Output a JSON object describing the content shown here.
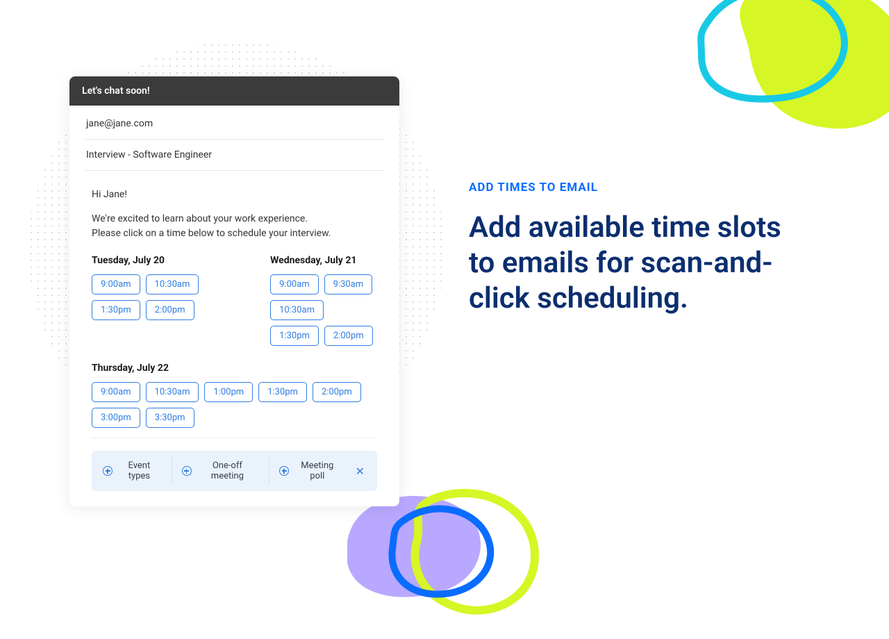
{
  "promo": {
    "eyebrow": "ADD TIMES TO EMAIL",
    "headline": "Add available time slots to emails for scan-and-click scheduling."
  },
  "email": {
    "window_title": "Let's chat soon!",
    "to": "jane@jane.com",
    "subject": "Interview - Software Engineer",
    "greeting": "Hi Jane!",
    "body_line1": "We're excited to learn about your work experience.",
    "body_line2": "Please click on a time below to schedule your interview.",
    "days": [
      {
        "label": "Tuesday, July 20",
        "slots": [
          "9:00am",
          "10:30am",
          "1:30pm",
          "2:00pm"
        ]
      },
      {
        "label": "Wednesday, July 21",
        "slots": [
          "9:00am",
          "9:30am",
          "10:30am",
          "1:30pm",
          "2:00pm"
        ]
      },
      {
        "label": "Thursday, July 22",
        "slots": [
          "9:00am",
          "10:30am",
          "1:00pm",
          "1:30pm",
          "2:00pm",
          "3:00pm",
          "3:30pm"
        ]
      }
    ]
  },
  "toolbar": {
    "event_types": "Event types",
    "one_off": "One-off meeting",
    "poll": "Meeting poll"
  }
}
